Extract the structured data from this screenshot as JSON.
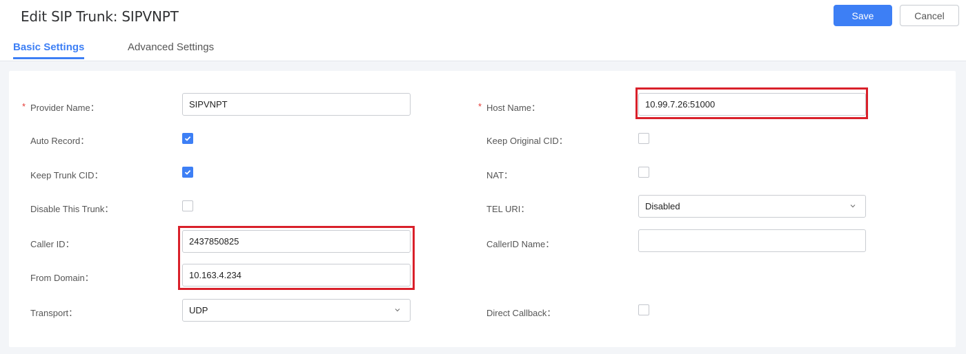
{
  "header": {
    "title": "Edit SIP Trunk: SIPVNPT",
    "save_label": "Save",
    "cancel_label": "Cancel"
  },
  "tabs": [
    {
      "label": "Basic Settings",
      "active": true
    },
    {
      "label": "Advanced Settings",
      "active": false
    }
  ],
  "form": {
    "left": {
      "provider_name": {
        "label": "Provider Name：",
        "value": "SIPVNPT",
        "required": true
      },
      "auto_record": {
        "label": "Auto Record：",
        "checked": true
      },
      "keep_trunk_cid": {
        "label": "Keep Trunk CID：",
        "checked": true
      },
      "disable_this_trunk": {
        "label": "Disable This Trunk：",
        "checked": false
      },
      "caller_id": {
        "label": "Caller ID：",
        "value": "2437850825"
      },
      "from_domain": {
        "label": "From Domain：",
        "value": "10.163.4.234"
      },
      "transport": {
        "label": "Transport：",
        "value": "UDP"
      }
    },
    "right": {
      "host_name": {
        "label": "Host Name：",
        "value": "10.99.7.26:51000",
        "required": true
      },
      "keep_original_cid": {
        "label": "Keep Original CID：",
        "checked": false
      },
      "nat": {
        "label": "NAT：",
        "checked": false
      },
      "tel_uri": {
        "label": "TEL URI：",
        "value": "Disabled"
      },
      "callerid_name": {
        "label": "CallerID Name：",
        "value": ""
      },
      "direct_callback": {
        "label": "Direct Callback：",
        "checked": false
      }
    }
  },
  "required_mark": "*",
  "colors": {
    "accent": "#3d7ff5",
    "highlight": "#d9202a",
    "required": "#e53935"
  }
}
